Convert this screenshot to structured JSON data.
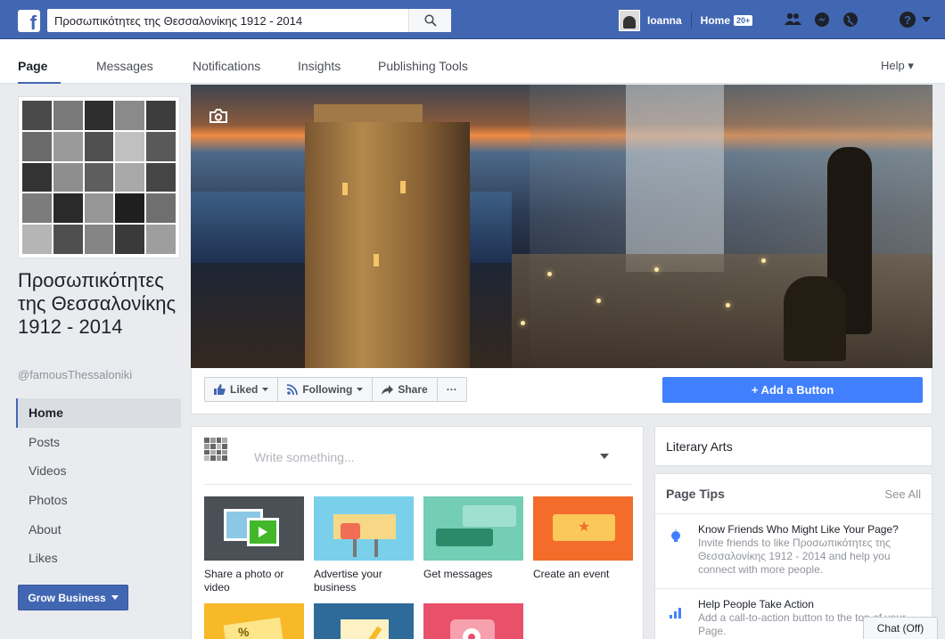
{
  "topbar": {
    "search_value": "Προσωπικότητες της Θεσσαλονίκης 1912 - 2014",
    "user_name": "Ioanna",
    "home_label": "Home",
    "home_badge": "20+"
  },
  "pagenav": {
    "tabs": [
      "Page",
      "Messages",
      "Notifications",
      "Insights",
      "Publishing Tools"
    ],
    "help_label": "Help ▾"
  },
  "page": {
    "name": "Προσωπικότητες της Θεσσαλονίκης 1912 - 2014",
    "handle": "@famousThessaloniki"
  },
  "leftnav": {
    "items": [
      "Home",
      "Posts",
      "Videos",
      "Photos",
      "About",
      "Likes"
    ],
    "grow_label": "Grow Business"
  },
  "actions": {
    "liked": "Liked",
    "following": "Following",
    "share": "Share",
    "more": "···",
    "add_button": "+ Add a Button"
  },
  "composer": {
    "placeholder": "Write something...",
    "tiles": [
      {
        "label": "Share a photo or video"
      },
      {
        "label": "Advertise your business"
      },
      {
        "label": "Get messages"
      },
      {
        "label": "Create an event"
      }
    ]
  },
  "right": {
    "category": "Literary Arts",
    "tips_title": "Page Tips",
    "see_all": "See All",
    "tips": [
      {
        "title": "Know Friends Who Might Like Your Page?",
        "body": "Invite friends to like Προσωπικότητες της Θεσσαλονίκης 1912 - 2014 and help you connect with more people."
      },
      {
        "title": "Help People Take Action",
        "body": "Add a call-to-action button to the top of your Page."
      }
    ]
  },
  "chat_label": "Chat (Off)",
  "colors": {
    "brand": "#4267b2",
    "add_button": "#4080ff"
  }
}
